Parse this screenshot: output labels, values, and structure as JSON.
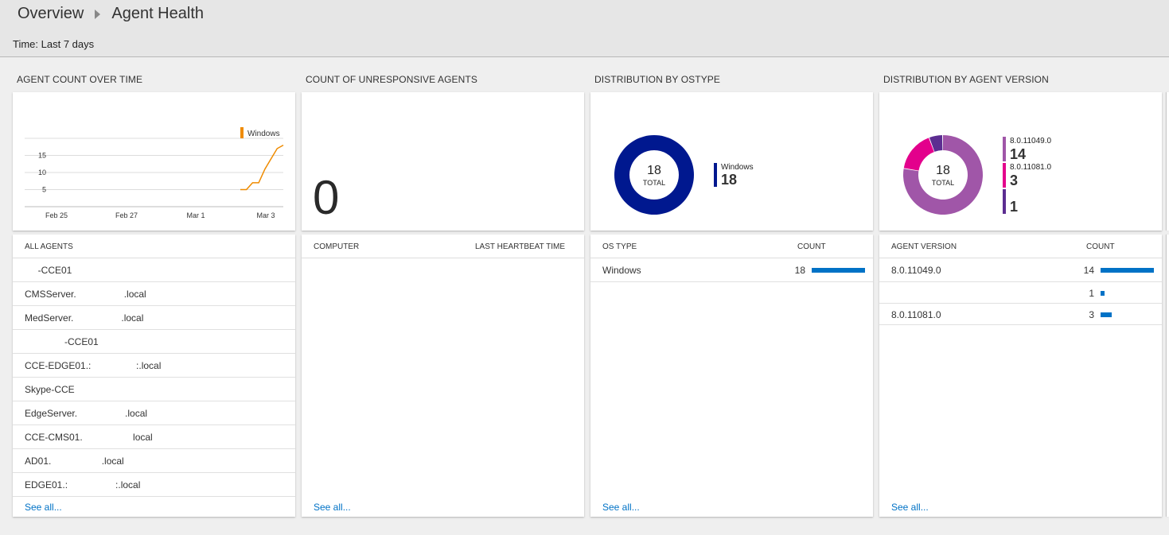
{
  "breadcrumb": {
    "root": "Overview",
    "current": "Agent Health"
  },
  "time_filter": "Time: Last 7 days",
  "tiles": {
    "agent_count": {
      "title": "AGENT COUNT OVER TIME",
      "legend": "Windows",
      "y_ticks": [
        "15",
        "10",
        "5"
      ],
      "x_ticks": [
        "Feb 25",
        "Feb 27",
        "Mar 1",
        "Mar 3"
      ]
    },
    "unresponsive": {
      "title": "COUNT OF UNRESPONSIVE AGENTS",
      "value": "0"
    },
    "ostype": {
      "title": "DISTRIBUTION BY OSTYPE",
      "total": "18",
      "total_label": "TOTAL",
      "legend": [
        {
          "name": "Windows",
          "value": "18",
          "color": "#00188f"
        }
      ]
    },
    "version": {
      "title": "DISTRIBUTION BY AGENT VERSION",
      "total": "18",
      "total_label": "TOTAL",
      "legend": [
        {
          "name": "8.0.11049.0",
          "value": "14",
          "color": "#a056a8"
        },
        {
          "name": "8.0.11081.0",
          "value": "3",
          "color": "#e3008c"
        },
        {
          "name": "",
          "value": "1",
          "color": "#5c2d91"
        }
      ]
    }
  },
  "panels": {
    "all_agents": {
      "header": "ALL AGENTS",
      "rows": [
        "     -CCE01",
        "CMSServer.                  .local",
        "MedServer.                  .local",
        "               -CCE01",
        "CCE-EDGE01.:                 :.local",
        "Skype-CCE",
        "EdgeServer.                  .local",
        "CCE-CMS01.                   local",
        "AD01.                   .local",
        "EDGE01.:                  :.local"
      ],
      "see_all": "See all..."
    },
    "unresponsive": {
      "header_left": "COMPUTER",
      "header_right": "LAST HEARTBEAT TIME",
      "see_all": "See all..."
    },
    "ostype": {
      "header_left": "OS TYPE",
      "header_right": "COUNT",
      "rows": [
        {
          "label": "Windows",
          "count": "18",
          "fraction": 1.0
        }
      ],
      "see_all": "See all..."
    },
    "version": {
      "header_left": "AGENT VERSION",
      "header_right": "COUNT",
      "rows": [
        {
          "label": "8.0.11049.0",
          "count": "14",
          "fraction": 1.0
        },
        {
          "label": "",
          "count": "1",
          "fraction": 0.07
        },
        {
          "label": "8.0.11081.0",
          "count": "3",
          "fraction": 0.21
        }
      ],
      "see_all": "See all..."
    }
  },
  "chart_data": {
    "type": "line",
    "title": "AGENT COUNT OVER TIME",
    "x": [
      "Mar 2 a",
      "Mar 2 b",
      "Mar 2 c",
      "Mar 2 d",
      "Mar 3 a",
      "Mar 3 b",
      "Mar 3 c",
      "Mar 3 d"
    ],
    "series": [
      {
        "name": "Windows",
        "values": [
          5,
          5,
          7,
          7,
          11,
          14,
          17,
          18
        ]
      }
    ],
    "ylim": [
      0,
      20
    ],
    "xlabels": [
      "Feb 25",
      "Feb 27",
      "Mar 1",
      "Mar 3"
    ],
    "color": "#ef8b00",
    "grid": true,
    "legend": "top-right"
  }
}
